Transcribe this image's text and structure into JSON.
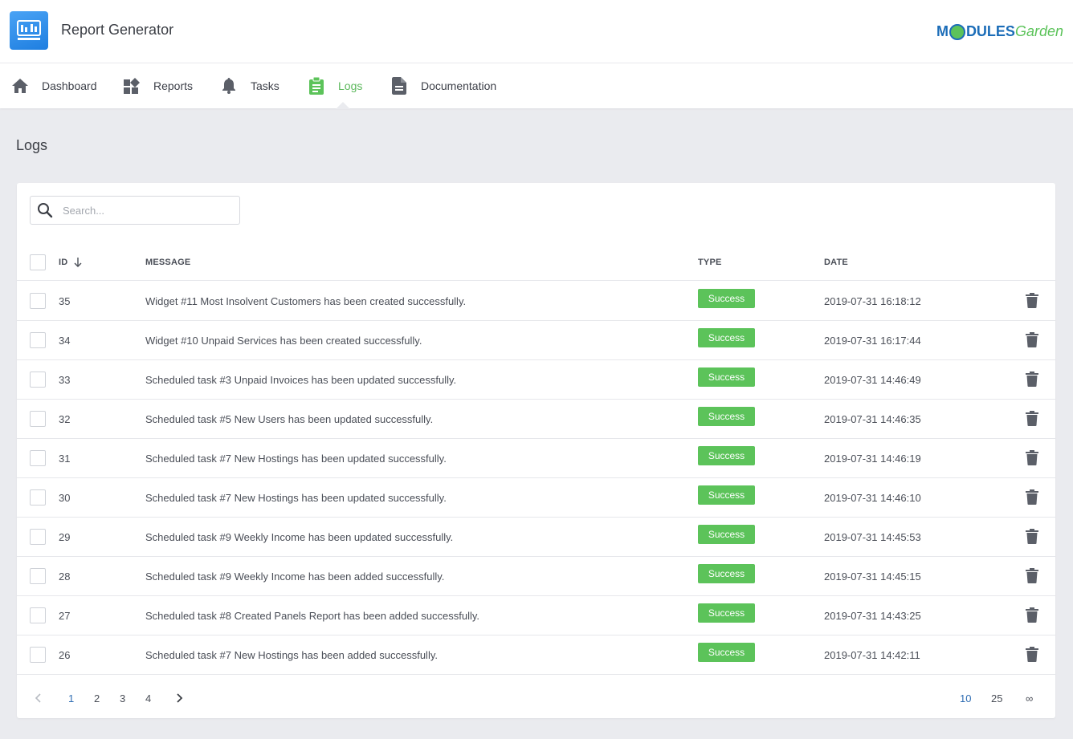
{
  "app": {
    "title": "Report Generator",
    "logo_text_a": "M",
    "logo_text_b": "DULES",
    "logo_text_c": "Garden"
  },
  "nav": {
    "items": [
      {
        "label": "Dashboard",
        "icon": "home-icon"
      },
      {
        "label": "Reports",
        "icon": "widgets-icon"
      },
      {
        "label": "Tasks",
        "icon": "bell-icon"
      },
      {
        "label": "Logs",
        "icon": "clipboard-icon",
        "active": true
      },
      {
        "label": "Documentation",
        "icon": "document-icon"
      }
    ]
  },
  "page": {
    "title": "Logs"
  },
  "search": {
    "placeholder": "Search..."
  },
  "table": {
    "headers": {
      "id": "ID",
      "message": "MESSAGE",
      "type": "TYPE",
      "date": "DATE"
    },
    "rows": [
      {
        "id": "35",
        "message": "Widget #11 Most Insolvent Customers has been created successfully.",
        "type": "Success",
        "date": "2019-07-31 16:18:12"
      },
      {
        "id": "34",
        "message": "Widget #10 Unpaid Services has been created successfully.",
        "type": "Success",
        "date": "2019-07-31 16:17:44"
      },
      {
        "id": "33",
        "message": "Scheduled task #3 Unpaid Invoices has been updated successfully.",
        "type": "Success",
        "date": "2019-07-31 14:46:49"
      },
      {
        "id": "32",
        "message": "Scheduled task #5 New Users has been updated successfully.",
        "type": "Success",
        "date": "2019-07-31 14:46:35"
      },
      {
        "id": "31",
        "message": "Scheduled task #7 New Hostings has been updated successfully.",
        "type": "Success",
        "date": "2019-07-31 14:46:19"
      },
      {
        "id": "30",
        "message": "Scheduled task #7 New Hostings has been updated successfully.",
        "type": "Success",
        "date": "2019-07-31 14:46:10"
      },
      {
        "id": "29",
        "message": "Scheduled task #9 Weekly Income has been updated successfully.",
        "type": "Success",
        "date": "2019-07-31 14:45:53"
      },
      {
        "id": "28",
        "message": "Scheduled task #9 Weekly Income has been added successfully.",
        "type": "Success",
        "date": "2019-07-31 14:45:15"
      },
      {
        "id": "27",
        "message": "Scheduled task #8 Created Panels Report has been added successfully.",
        "type": "Success",
        "date": "2019-07-31 14:43:25"
      },
      {
        "id": "26",
        "message": "Scheduled task #7 New Hostings has been added successfully.",
        "type": "Success",
        "date": "2019-07-31 14:42:11"
      }
    ]
  },
  "pagination": {
    "pages": [
      "1",
      "2",
      "3",
      "4"
    ],
    "current_page": "1",
    "page_sizes": [
      "10",
      "25",
      "∞"
    ],
    "current_size": "10"
  },
  "colors": {
    "accent_green": "#5cc35a",
    "accent_blue": "#2f6db3",
    "background": "#eaebef"
  }
}
